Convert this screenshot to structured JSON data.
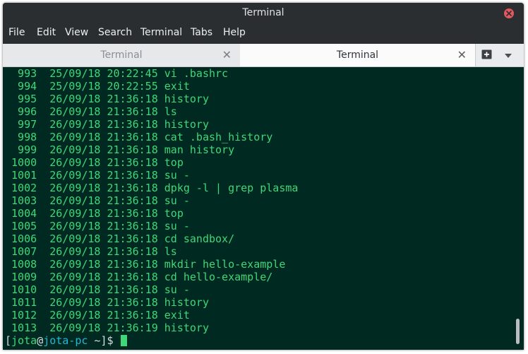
{
  "window": {
    "title": "Terminal"
  },
  "menu": [
    "File",
    "Edit",
    "View",
    "Search",
    "Terminal",
    "Tabs",
    "Help"
  ],
  "tabs": [
    {
      "label": "Terminal",
      "active": false
    },
    {
      "label": "Terminal",
      "active": true
    }
  ],
  "history": [
    {
      "num": "993",
      "date": "25/09/18",
      "time": "20:22:45",
      "cmd": "vi .bashrc"
    },
    {
      "num": "994",
      "date": "25/09/18",
      "time": "20:22:55",
      "cmd": "exit"
    },
    {
      "num": "995",
      "date": "26/09/18",
      "time": "21:36:18",
      "cmd": "history"
    },
    {
      "num": "996",
      "date": "26/09/18",
      "time": "21:36:18",
      "cmd": "ls"
    },
    {
      "num": "997",
      "date": "26/09/18",
      "time": "21:36:18",
      "cmd": "history"
    },
    {
      "num": "998",
      "date": "26/09/18",
      "time": "21:36:18",
      "cmd": "cat .bash_history"
    },
    {
      "num": "999",
      "date": "26/09/18",
      "time": "21:36:18",
      "cmd": "man history"
    },
    {
      "num": "1000",
      "date": "26/09/18",
      "time": "21:36:18",
      "cmd": "top"
    },
    {
      "num": "1001",
      "date": "26/09/18",
      "time": "21:36:18",
      "cmd": "su -"
    },
    {
      "num": "1002",
      "date": "26/09/18",
      "time": "21:36:18",
      "cmd": "dpkg -l | grep plasma"
    },
    {
      "num": "1003",
      "date": "26/09/18",
      "time": "21:36:18",
      "cmd": "su -"
    },
    {
      "num": "1004",
      "date": "26/09/18",
      "time": "21:36:18",
      "cmd": "top"
    },
    {
      "num": "1005",
      "date": "26/09/18",
      "time": "21:36:18",
      "cmd": "su -"
    },
    {
      "num": "1006",
      "date": "26/09/18",
      "time": "21:36:18",
      "cmd": "cd sandbox/"
    },
    {
      "num": "1007",
      "date": "26/09/18",
      "time": "21:36:18",
      "cmd": "ls"
    },
    {
      "num": "1008",
      "date": "26/09/18",
      "time": "21:36:18",
      "cmd": "mkdir hello-example"
    },
    {
      "num": "1009",
      "date": "26/09/18",
      "time": "21:36:18",
      "cmd": "cd hello-example/"
    },
    {
      "num": "1010",
      "date": "26/09/18",
      "time": "21:36:18",
      "cmd": "su -"
    },
    {
      "num": "1011",
      "date": "26/09/18",
      "time": "21:36:18",
      "cmd": "history"
    },
    {
      "num": "1012",
      "date": "26/09/18",
      "time": "21:36:18",
      "cmd": "exit"
    },
    {
      "num": "1013",
      "date": "26/09/18",
      "time": "21:36:19",
      "cmd": "history"
    }
  ],
  "prompt": {
    "open": "[",
    "user": "jota",
    "at": "@",
    "host": "jota-pc",
    "path": " ~]$ "
  },
  "colors": {
    "terminal_bg": "#002a21",
    "text_green": "#3fd777",
    "host_cyan": "#1fb8d6",
    "titlebar": "#2b2e31",
    "close_red": "#e2585e"
  },
  "icons": {
    "close": "close-icon",
    "new_tab": "new-tab-icon",
    "tab_menu": "chevron-down-icon"
  }
}
